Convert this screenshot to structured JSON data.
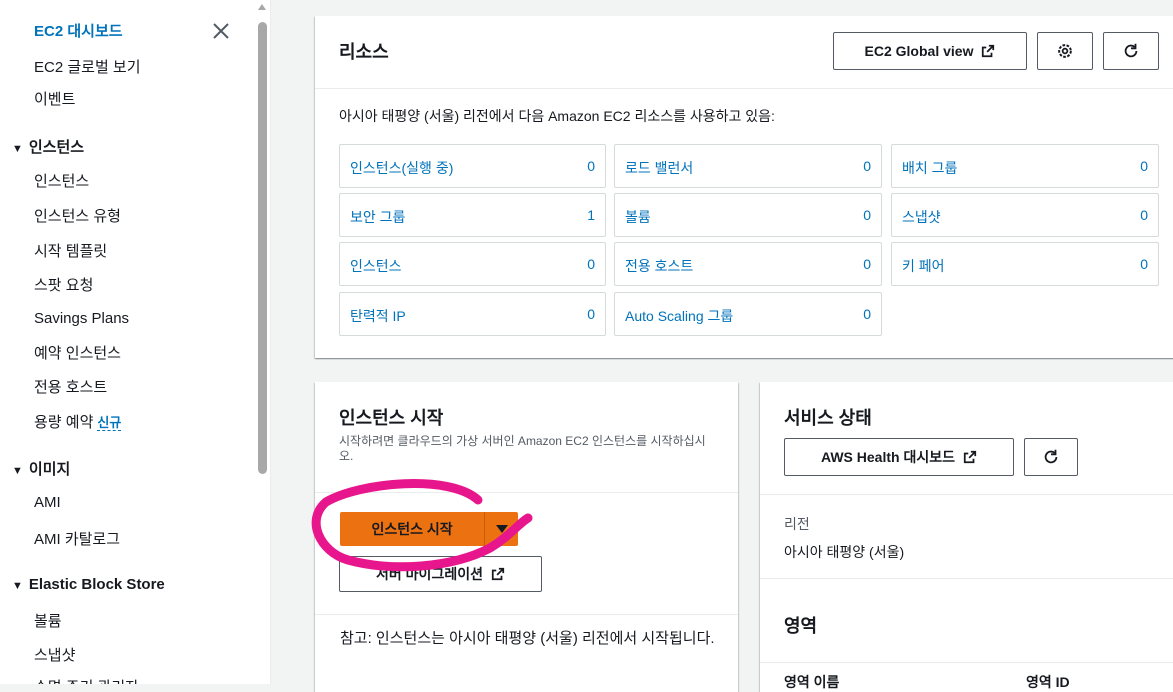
{
  "sidebar": {
    "dashboard": "EC2 대시보드",
    "global_view": "EC2 글로벌 보기",
    "events": "이벤트",
    "sections": [
      {
        "title": "인스턴스",
        "items": [
          "인스턴스",
          "인스턴스 유형",
          "시작 템플릿",
          "스팟 요청",
          "Savings Plans",
          "예약 인스턴스",
          "전용 호스트",
          "용량 예약"
        ]
      },
      {
        "title": "이미지",
        "items": [
          "AMI",
          "AMI 카탈로그"
        ]
      },
      {
        "title": "Elastic Block Store",
        "items": [
          "볼륨",
          "스냅샷",
          "수명 주기 관리자"
        ]
      }
    ],
    "new_badge": "신규"
  },
  "resources": {
    "title": "리소스",
    "global_view_button": "EC2 Global view",
    "description": "아시아 태평양 (서울) 리전에서 다음 Amazon EC2 리소스를 사용하고 있음:",
    "tiles": [
      {
        "label": "인스턴스(실행 중)",
        "value": "0"
      },
      {
        "label": "로드 밸런서",
        "value": "0"
      },
      {
        "label": "배치 그룹",
        "value": "0"
      },
      {
        "label": "보안 그룹",
        "value": "1"
      },
      {
        "label": "볼륨",
        "value": "0"
      },
      {
        "label": "스냅샷",
        "value": "0"
      },
      {
        "label": "인스턴스",
        "value": "0"
      },
      {
        "label": "전용 호스트",
        "value": "0"
      },
      {
        "label": "키 페어",
        "value": "0"
      },
      {
        "label": "탄력적 IP",
        "value": "0"
      },
      {
        "label": "Auto Scaling 그룹",
        "value": "0"
      }
    ]
  },
  "launch": {
    "title": "인스턴스 시작",
    "description": "시작하려면 클라우드의 가상 서버인 Amazon EC2 인스턴스를 시작하십시오.",
    "launch_button": "인스턴스 시작",
    "migrate_button": "서버 마이그레이션",
    "note": "참고: 인스턴스는 아시아 태평양 (서울) 리전에서 시작됩니다."
  },
  "service_health": {
    "title": "서비스 상태",
    "health_button": "AWS Health 대시보드",
    "region_label": "리전",
    "region_value": "아시아 태평양 (서울)",
    "zones_title": "영역",
    "zone_name_header": "영역 이름",
    "zone_id_header": "영역 ID"
  },
  "colors": {
    "link": "#0073bb",
    "primary_button": "#ec7211",
    "annotation": "#e8168c"
  }
}
